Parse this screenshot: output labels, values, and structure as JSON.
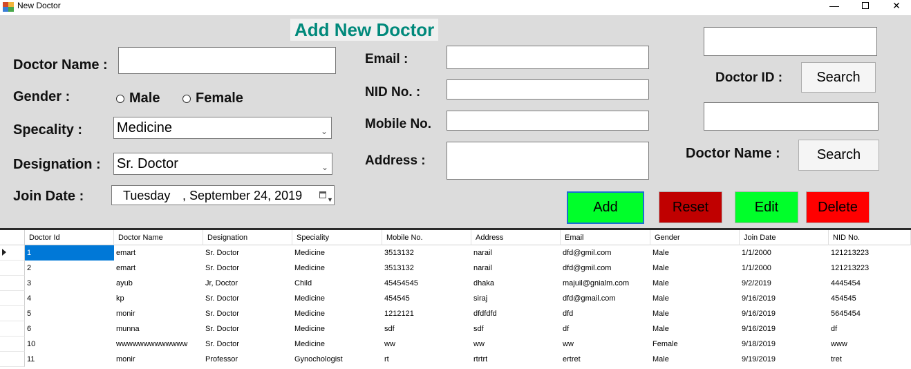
{
  "window": {
    "title": "New Doctor",
    "min_glyph": "—",
    "close_glyph": "✕"
  },
  "heading": "Add New Doctor",
  "form": {
    "doctor_name_label": "Doctor Name :",
    "doctor_name_value": "",
    "gender_label": "Gender :",
    "gender_options": [
      "Male",
      "Female"
    ],
    "speciality_label": "Specality :",
    "speciality_value": "Medicine",
    "designation_label": "Designation :",
    "designation_value": "Sr. Doctor",
    "join_date_label": "Join Date :",
    "join_date_day": "Tuesday",
    "join_date_date": ", September 24, 2019",
    "email_label": "Email :",
    "email_value": "",
    "nid_label": "NID No. :",
    "nid_value": "",
    "mobile_label": "Mobile No.",
    "mobile_value": "",
    "address_label": "Address :",
    "address_value": ""
  },
  "search": {
    "doctor_id_label": "Doctor ID :",
    "doctor_id_value": "",
    "doctor_id_button": "Search",
    "doctor_name_label": "Doctor Name :",
    "doctor_name_value": "",
    "doctor_name_button": "Search"
  },
  "actions": {
    "add": "Add",
    "reset": "Reset",
    "edit": "Edit",
    "delete": "Delete"
  },
  "colors": {
    "form_bg": "#dcdcdc",
    "heading": "#00897b",
    "add": "#00ff2a",
    "reset": "#c00000",
    "edit": "#00ff2a",
    "delete": "#ff0000",
    "selection": "#0078d7"
  },
  "grid": {
    "columns": [
      "Doctor Id",
      "Doctor Name",
      "Designation",
      "Speciality",
      "Mobile No.",
      "Address",
      "Email",
      "Gender",
      "Join Date",
      "NID No."
    ],
    "rows": [
      [
        "1",
        "emart",
        "Sr. Doctor",
        "Medicine",
        "3513132",
        "narail",
        "dfd@gmil.com",
        "Male",
        "1/1/2000",
        "121213223"
      ],
      [
        "2",
        "emart",
        "Sr. Doctor",
        "Medicine",
        "3513132",
        "narail",
        "dfd@gmil.com",
        "Male",
        "1/1/2000",
        "121213223"
      ],
      [
        "3",
        "ayub",
        "Jr, Doctor",
        "Child",
        "45454545",
        "dhaka",
        "majuil@gnialm.com",
        "Male",
        "9/2/2019",
        "4445454"
      ],
      [
        "4",
        "kp",
        "Sr. Doctor",
        "Medicine",
        "454545",
        "siraj",
        "dfd@gmail.com",
        "Male",
        "9/16/2019",
        "454545"
      ],
      [
        "5",
        "monir",
        "Sr. Doctor",
        "Medicine",
        "1212121",
        "dfdfdfd",
        "dfd",
        "Male",
        "9/16/2019",
        "5645454"
      ],
      [
        "6",
        "munna",
        "Sr. Doctor",
        "Medicine",
        "sdf",
        "sdf",
        "df",
        "Male",
        "9/16/2019",
        "df"
      ],
      [
        "10",
        "wwwwwwwwwwwww",
        "Sr. Doctor",
        "Medicine",
        "ww",
        "ww",
        "ww",
        "Female",
        "9/18/2019",
        "www"
      ],
      [
        "11",
        "monir",
        "Professor",
        "Gynochologist",
        "rt",
        "rtrtrt",
        "ertret",
        "Male",
        "9/19/2019",
        "tret"
      ]
    ]
  }
}
